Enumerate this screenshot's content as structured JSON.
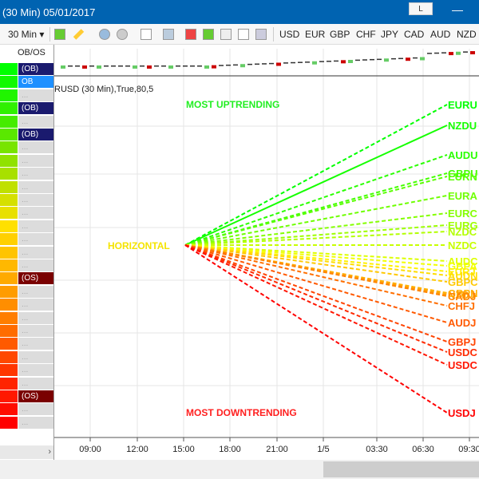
{
  "window": {
    "title": "(30 Min)  05/01/2017",
    "button_l": "L",
    "minimize": "—"
  },
  "toolbar": {
    "interval": "30 Min",
    "currencies": [
      "USD",
      "EUR",
      "GBP",
      "CHF",
      "JPY",
      "CAD",
      "AUD",
      "NZD"
    ]
  },
  "table": {
    "header": "OB/OS",
    "rows": [
      {
        "color": "#00ff00",
        "obos": "(OB)",
        "state": "ob"
      },
      {
        "color": "#10fa00",
        "obos": "OB",
        "state": "sel"
      },
      {
        "color": "#20f500",
        "obos": "...",
        "state": ""
      },
      {
        "color": "#30f000",
        "obos": "(OB)",
        "state": "ob"
      },
      {
        "color": "#45ec00",
        "obos": "...",
        "state": ""
      },
      {
        "color": "#5ae800",
        "obos": "(OB)",
        "state": "ob"
      },
      {
        "color": "#78e400",
        "obos": "...",
        "state": ""
      },
      {
        "color": "#90e200",
        "obos": "...",
        "state": ""
      },
      {
        "color": "#a8e000",
        "obos": "...",
        "state": ""
      },
      {
        "color": "#c0e000",
        "obos": "...",
        "state": ""
      },
      {
        "color": "#d5e000",
        "obos": "...",
        "state": ""
      },
      {
        "color": "#e8e000",
        "obos": "...",
        "state": ""
      },
      {
        "color": "#ffe000",
        "obos": "...",
        "state": ""
      },
      {
        "color": "#ffd000",
        "obos": "...",
        "state": ""
      },
      {
        "color": "#ffc400",
        "obos": "...",
        "state": ""
      },
      {
        "color": "#ffb800",
        "obos": "...",
        "state": ""
      },
      {
        "color": "#ffaa00",
        "obos": "(OS)",
        "state": "os"
      },
      {
        "color": "#ff9c00",
        "obos": "...",
        "state": ""
      },
      {
        "color": "#ff8e00",
        "obos": "...",
        "state": ""
      },
      {
        "color": "#ff7e00",
        "obos": "...",
        "state": ""
      },
      {
        "color": "#ff6c00",
        "obos": "...",
        "state": ""
      },
      {
        "color": "#ff5a00",
        "obos": "...",
        "state": ""
      },
      {
        "color": "#ff4800",
        "obos": "...",
        "state": ""
      },
      {
        "color": "#ff3600",
        "obos": "...",
        "state": ""
      },
      {
        "color": "#ff2400",
        "obos": "...",
        "state": ""
      },
      {
        "color": "#ff1800",
        "obos": "(OS)",
        "state": "os"
      },
      {
        "color": "#ff0c00",
        "obos": "...",
        "state": ""
      },
      {
        "color": "#ff0000",
        "obos": "...",
        "state": ""
      }
    ]
  },
  "chart": {
    "indicator_title": "RUSD (30 Min),True,80,5",
    "most_up": "MOST UPTRENDING",
    "horizontal": "HORIZONTAL",
    "most_down": "MOST DOWNTRENDING",
    "x_ticks": [
      "09:00",
      "12:00",
      "15:00",
      "18:00",
      "21:00",
      "1/5",
      "03:30",
      "06:30",
      "09:30"
    ],
    "pairs": [
      "EURU",
      "NZDU",
      "AUDU",
      "GBPU",
      "EURN",
      "EURA",
      "EURC",
      "EURG",
      "NZDC",
      "NZDC",
      "AUDC",
      "GBPA",
      "EURJ",
      "AUDN",
      "GBPC",
      "GBPN",
      "NZDJ",
      "CADJ",
      "CHFJ",
      "AUDJ",
      "GBPJ",
      "USDC",
      "USDC",
      "USDJ"
    ]
  }
}
